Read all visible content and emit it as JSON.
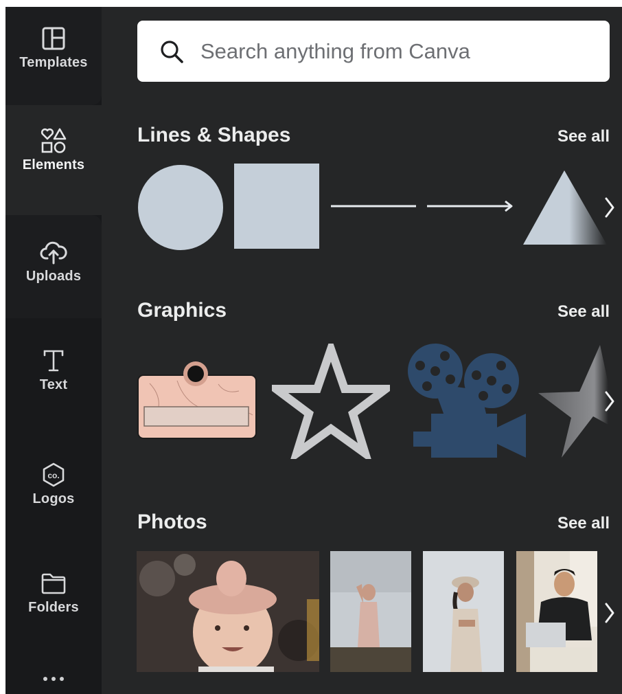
{
  "sidebar": {
    "items": [
      {
        "label": "Templates",
        "icon": "templates-icon"
      },
      {
        "label": "Elements",
        "icon": "elements-icon"
      },
      {
        "label": "Uploads",
        "icon": "upload-cloud-icon"
      },
      {
        "label": "Text",
        "icon": "text-t-icon"
      },
      {
        "label": "Logos",
        "icon": "logo-co-icon"
      },
      {
        "label": "Folders",
        "icon": "folder-icon"
      }
    ],
    "more_icon": "more-dots-icon"
  },
  "search": {
    "placeholder": "Search anything from Canva",
    "value": "",
    "icon": "search-icon"
  },
  "sections": [
    {
      "title": "Lines & Shapes",
      "see_all": "See all"
    },
    {
      "title": "Graphics",
      "see_all": "See all"
    },
    {
      "title": "Photos",
      "see_all": "See all"
    }
  ],
  "colors": {
    "panel_bg": "#252627",
    "rail_bg": "#18191b",
    "shape_fill": "#c5cfd9",
    "graphic_blue": "#2e4a6b",
    "tag_pink": "#f0c4b4",
    "text": "#eceded"
  }
}
